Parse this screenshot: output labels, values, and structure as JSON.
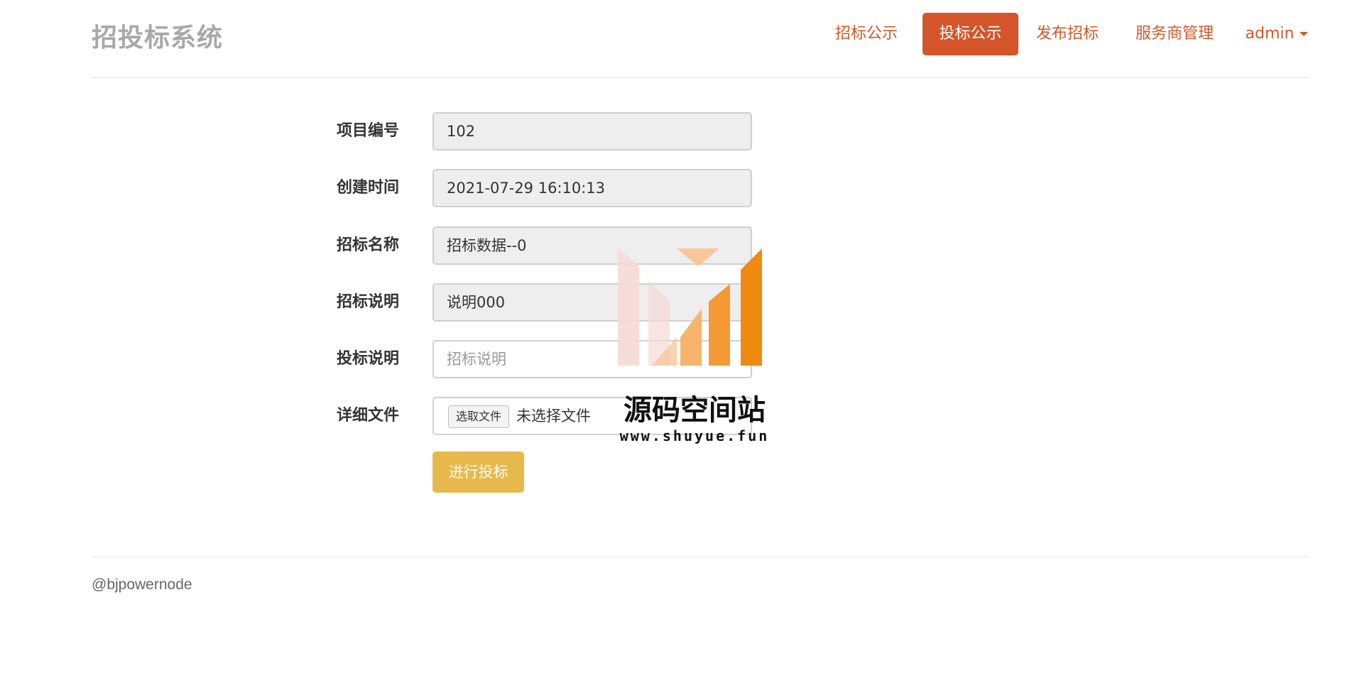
{
  "header": {
    "brand": "招投标系统",
    "nav": [
      {
        "label": "招标公示",
        "active": false
      },
      {
        "label": "投标公示",
        "active": true
      },
      {
        "label": "发布招标",
        "active": false
      },
      {
        "label": "服务商管理",
        "active": false
      },
      {
        "label": "admin",
        "active": false,
        "dropdown": true
      }
    ]
  },
  "form": {
    "project_no_label": "项目编号",
    "project_no_value": "102",
    "created_label": "创建时间",
    "created_value": "2021-07-29 16:10:13",
    "tender_name_label": "招标名称",
    "tender_name_value": "招标数据--0",
    "tender_desc_label": "招标说明",
    "tender_desc_value": "说明000",
    "bid_desc_label": "投标说明",
    "bid_desc_placeholder": "招标说明",
    "file_label": "详细文件",
    "file_button": "选取文件",
    "file_status": "未选择文件",
    "submit_label": "进行投标"
  },
  "footer": {
    "text": "@bjpowernode"
  },
  "watermark": {
    "title": "源码空间站",
    "url": "www.shuyue.fun"
  },
  "colors": {
    "accent": "#d4552a",
    "nav_text": "#cc5a2b",
    "submit": "#e7b94d"
  }
}
